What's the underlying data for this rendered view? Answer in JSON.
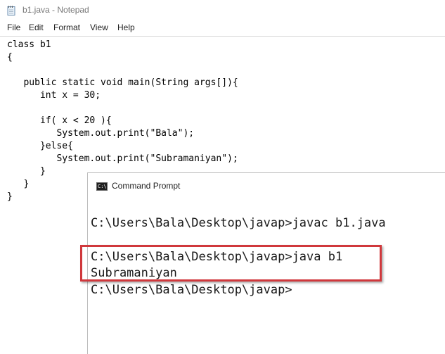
{
  "notepad": {
    "title": "b1.java - Notepad",
    "icon": "notepad-icon",
    "menu": [
      "File",
      "Edit",
      "Format",
      "View",
      "Help"
    ],
    "code_lines": [
      "class b1",
      "{",
      "",
      "   public static void main(String args[]){",
      "      int x = 30;",
      "",
      "      if( x < 20 ){",
      "         System.out.print(\"Bala\");",
      "      }else{",
      "         System.out.print(\"Subramaniyan\");",
      "      }",
      "   }",
      "}"
    ]
  },
  "cmd": {
    "title": "Command Prompt",
    "icon": "command-prompt-icon",
    "lines": [
      "C:\\Users\\Bala\\Desktop\\javap>javac b1.java",
      "",
      "C:\\Users\\Bala\\Desktop\\javap>java b1",
      "Subramaniyan",
      "C:\\Users\\Bala\\Desktop\\javap>"
    ],
    "highlight_color": "#d0383c"
  }
}
